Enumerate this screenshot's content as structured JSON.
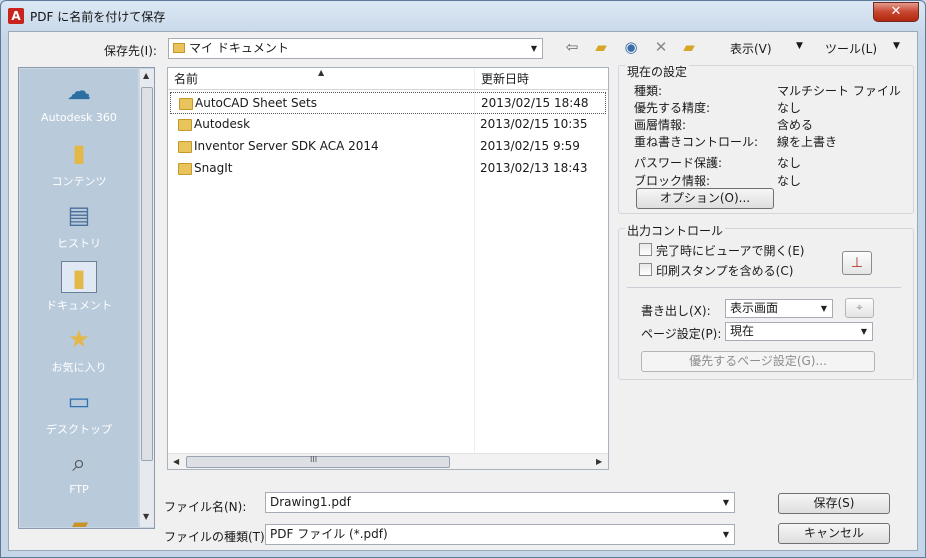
{
  "window": {
    "title": "PDF に名前を付けて保存",
    "close": "✕",
    "app_icon": "A"
  },
  "savein": {
    "label": "保存先(I):",
    "value": "マイ ドキュメント"
  },
  "toolbar": {
    "icons": [
      "back-icon",
      "up-folder-icon",
      "search-web-icon",
      "delete-icon",
      "new-folder-icon"
    ],
    "view_label": "表示(V)",
    "tools_label": "ツール(L)"
  },
  "places": [
    {
      "label": "Autodesk 360",
      "icon": "cloud-icon"
    },
    {
      "label": "コンテンツ",
      "icon": "folder-icon"
    },
    {
      "label": "ヒストリ",
      "icon": "history-icon"
    },
    {
      "label": "ドキュメント",
      "icon": "documents-icon"
    },
    {
      "label": "お気に入り",
      "icon": "favorites-icon"
    },
    {
      "label": "デスクトップ",
      "icon": "desktop-icon"
    },
    {
      "label": "FTP",
      "icon": "ftp-icon"
    }
  ],
  "filelist": {
    "columns": {
      "name": "名前",
      "date": "更新日時"
    },
    "rows": [
      {
        "name": "AutoCAD Sheet Sets",
        "date": "2013/02/15 18:48"
      },
      {
        "name": "Autodesk",
        "date": "2013/02/15 10:35"
      },
      {
        "name": "Inventor Server SDK ACA 2014",
        "date": "2013/02/15 9:59"
      },
      {
        "name": "SnagIt",
        "date": "2013/02/13 18:43"
      }
    ],
    "scroll_grip": "III"
  },
  "current_settings": {
    "title": "現在の設定",
    "items": [
      {
        "label": "種類:",
        "value": "マルチシート ファイル"
      },
      {
        "label": "優先する精度:",
        "value": "なし"
      },
      {
        "label": "画層情報:",
        "value": "含める"
      },
      {
        "label": "重ね書きコントロール:",
        "value": "線を上書き"
      },
      {
        "label": "パスワード保護:",
        "value": "なし"
      },
      {
        "label": "ブロック情報:",
        "value": "なし"
      }
    ],
    "options_button": "オプション(O)..."
  },
  "output_control": {
    "title": "出力コントロール",
    "open_viewer": "完了時にビューアで開く(E)",
    "include_stamp": "印刷スタンプを含める(C)",
    "export_label": "書き出し(X):",
    "export_value": "表示画面",
    "page_setup_label": "ページ設定(P):",
    "page_setup_value": "現在",
    "page_setup_override": "優先するページ設定(G)..."
  },
  "filename": {
    "label": "ファイル名(N):",
    "value": "Drawing1.pdf"
  },
  "filetype": {
    "label": "ファイルの種類(T):",
    "value": "PDF ファイル (*.pdf)"
  },
  "buttons": {
    "save": "保存(S)",
    "cancel": "キャンセル"
  }
}
